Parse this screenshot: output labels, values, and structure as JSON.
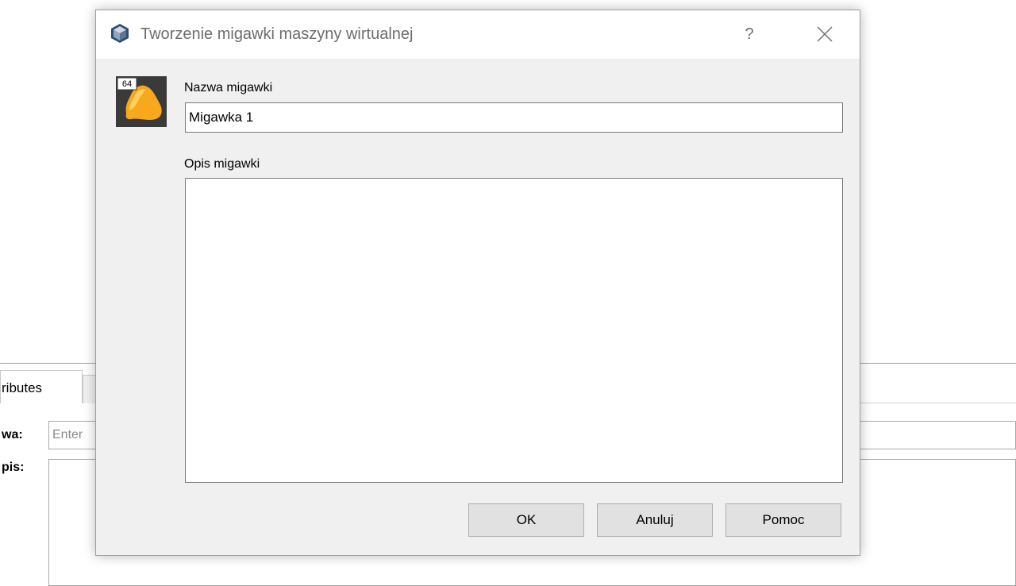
{
  "background_window": {
    "tab_label": "ributes",
    "name_label": "wa:",
    "name_placeholder": "Enter",
    "desc_label": "pis:"
  },
  "dialog": {
    "title": "Tworzenie migawki maszyny wirtualnej",
    "help_label": "?",
    "vm_badge": "64",
    "name_label": "Nazwa migawki",
    "name_value": "Migawka 1",
    "desc_label": "Opis migawki",
    "desc_value": "",
    "buttons": {
      "ok": "OK",
      "cancel": "Anuluj",
      "help": "Pomoc"
    }
  },
  "icons": {
    "title": "virtualbox-icon",
    "close": "close-icon",
    "vm": "vm-os-icon"
  },
  "colors": {
    "dialog_bg": "#f0f0f0",
    "titlebar_bg": "#ffffff",
    "button_bg": "#e1e1e1",
    "vm_icon_orange": "#f7a81c"
  }
}
